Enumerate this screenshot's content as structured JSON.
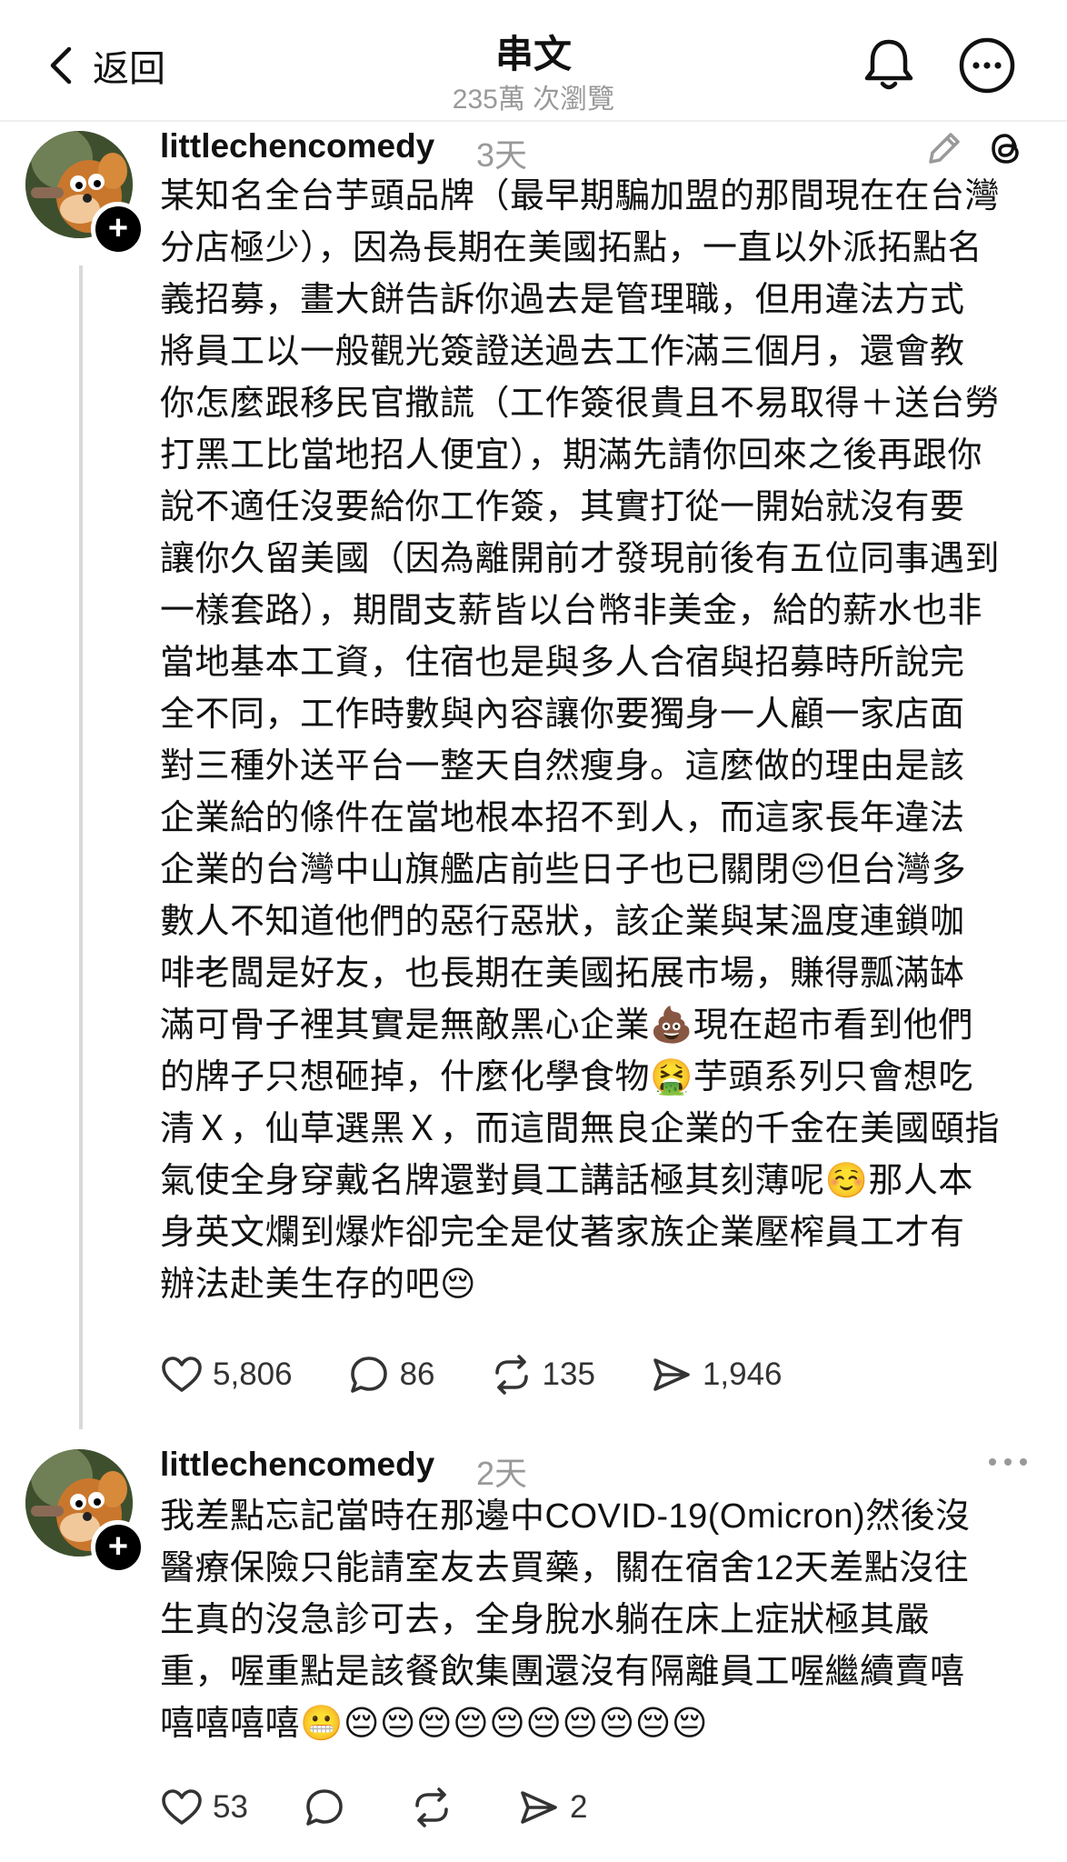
{
  "header": {
    "back_label": "返回",
    "title": "串文",
    "views": "235萬 次瀏覽"
  },
  "posts": [
    {
      "username": "littlechencomedy",
      "time": "3天",
      "lines": [
        "某知名全台芋頭品牌（最早期騙加盟的那間現在在台灣",
        "分店極少），因為長期在美國拓點，一直以外派拓點名",
        "義招募，畫大餅告訴你過去是管理職，但用違法方式",
        "將員工以一般觀光簽證送過去工作滿三個月，還會教",
        "你怎麼跟移民官撒謊（工作簽很貴且不易取得＋送台勞",
        "打黑工比當地招人便宜），期滿先請你回來之後再跟你",
        "說不適任沒要給你工作簽，其實打從一開始就沒有要",
        "讓你久留美國（因為離開前才發現前後有五位同事遇到",
        "一樣套路），期間支薪皆以台幣非美金，給的薪水也非",
        "當地基本工資，住宿也是與多人合宿與招募時所說完",
        "全不同，工作時數與內容讓你要獨身一人顧一家店面",
        "對三種外送平台一整天自然瘦身。這麼做的理由是該",
        "企業給的條件在當地根本招不到人，而這家長年違法",
        "企業的台灣中山旗艦店前些日子也已關閉😔但台灣多",
        "數人不知道他們的惡行惡狀，該企業與某溫度連鎖咖",
        "啡老闆是好友，也長期在美國拓展市場，賺得瓢滿缽",
        "滿可骨子裡其實是無敵黑心企業💩現在超市看到他們",
        "的牌子只想砸掉，什麼化學食物🤮芋頭系列只會想吃",
        "清Ｘ，仙草選黑Ｘ，而這間無良企業的千金在美國頤指",
        "氣使全身穿戴名牌還對員工講話極其刻薄呢☺️那人本",
        "身英文爛到爆炸卻完全是仗著家族企業壓榨員工才有",
        "辦法赴美生存的吧😔"
      ],
      "likes": "5,806",
      "replies": "86",
      "reposts": "135",
      "shares": "1,946"
    },
    {
      "username": "littlechencomedy",
      "time": "2天",
      "lines": [
        "我差點忘記當時在那邊中COVID-19(Omicron)然後沒",
        "醫療保險只能請室友去買藥，關在宿舍12天差點沒往",
        "生真的沒急診可去，全身脫水躺在床上症狀極其嚴",
        "重，喔重點是該餐飲集團還沒有隔離員工喔繼續賣嘻",
        "嘻嘻嘻嘻😬😔😔😔😔😔😔😔😔😔😔"
      ],
      "likes": "53",
      "replies": "",
      "reposts": "",
      "shares": "2"
    }
  ]
}
